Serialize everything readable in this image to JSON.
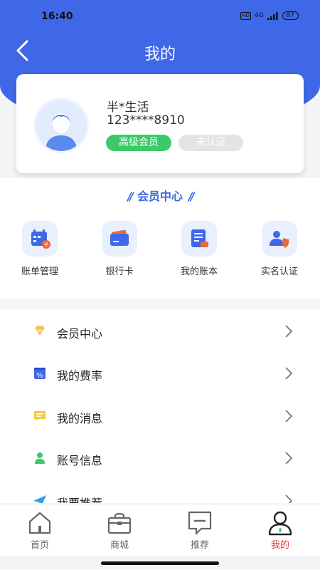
{
  "status_bar": {
    "time": "16:40",
    "hd": "HD",
    "network": "4G",
    "battery": "87"
  },
  "header": {
    "title": "我的"
  },
  "profile": {
    "name": "半*生活",
    "phone": "123****8910",
    "vip_badge": "高级会员",
    "auth_badge": "未认证"
  },
  "member_center": {
    "title": "会员中心",
    "items": [
      {
        "label": "账单管理",
        "icon": "bill-calendar-icon"
      },
      {
        "label": "银行卡",
        "icon": "bank-card-icon"
      },
      {
        "label": "我的账本",
        "icon": "ledger-icon"
      },
      {
        "label": "实名认证",
        "icon": "id-shield-icon"
      }
    ]
  },
  "menu": [
    {
      "label": "会员中心",
      "icon": "diamond-icon"
    },
    {
      "label": "我的费率",
      "icon": "percent-icon"
    },
    {
      "label": "我的消息",
      "icon": "message-icon"
    },
    {
      "label": "账号信息",
      "icon": "user-icon"
    },
    {
      "label": "我要推荐",
      "icon": "send-icon"
    }
  ],
  "tabbar": [
    {
      "label": "首页",
      "icon": "home-icon"
    },
    {
      "label": "商城",
      "icon": "shop-bag-icon"
    },
    {
      "label": "推荐",
      "icon": "recommend-icon"
    },
    {
      "label": "我的",
      "icon": "profile-icon",
      "active": true
    }
  ],
  "colors": {
    "primary": "#3e68e8",
    "vip_green": "#3cc96a",
    "active_tab": "#e53935",
    "accent_orange": "#ee6a35"
  }
}
